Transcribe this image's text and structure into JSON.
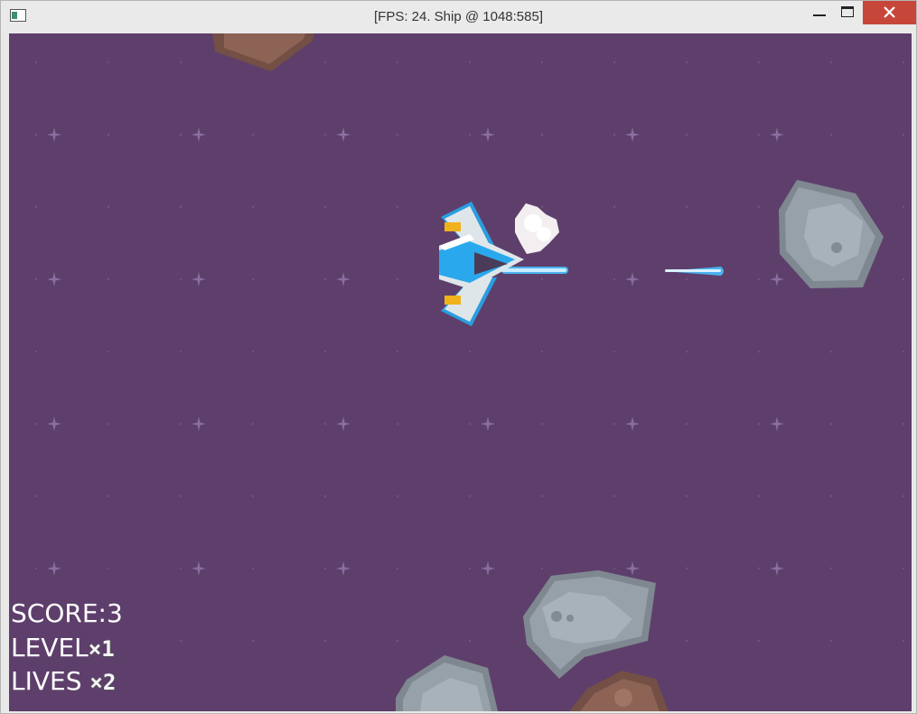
{
  "window": {
    "title": "[FPS: 24. Ship @ 1048:585]",
    "icons": [
      "app-icon",
      "minimize-icon",
      "maximize-icon",
      "close-icon"
    ],
    "close_color": "#c7463a"
  },
  "game": {
    "background_color": "#5e3f6c",
    "hud": {
      "score_label": "SCORE:3",
      "level_label": "LEVEL",
      "level_value": "×1",
      "lives_label": "LIVES ",
      "lives_value": "×2"
    },
    "sprites": [
      "player-ship",
      "laser-bolt",
      "explosion-puff",
      "gray-asteroid",
      "brown-asteroid",
      "star"
    ]
  }
}
